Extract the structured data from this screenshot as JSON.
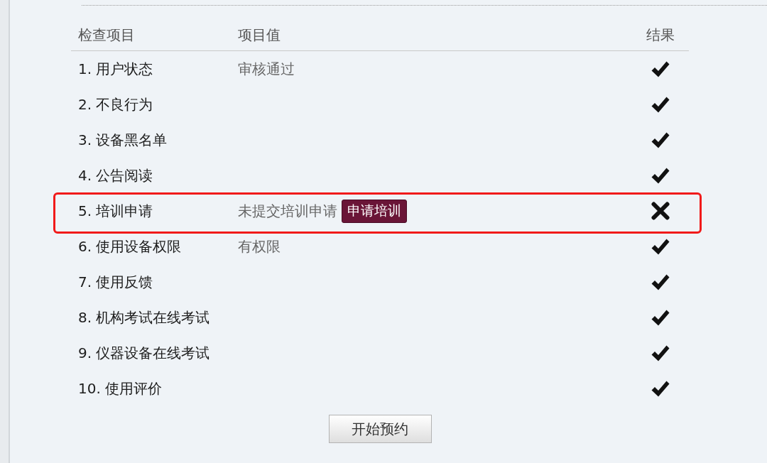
{
  "table": {
    "columns": [
      "检查项目",
      "项目值",
      "结果"
    ],
    "rows": [
      {
        "item": "1. 用户状态",
        "value": "审核通过",
        "passed": true,
        "highlighted": false
      },
      {
        "item": "2. 不良行为",
        "passed": true,
        "highlighted": false
      },
      {
        "item": "3. 设备黑名单",
        "passed": true,
        "highlighted": false
      },
      {
        "item": "4. 公告阅读",
        "passed": true,
        "highlighted": false
      },
      {
        "item": "5. 培训申请",
        "value": "未提交培训申请",
        "action": "申请培训",
        "passed": false,
        "highlighted": true
      },
      {
        "item": "6. 使用设备权限",
        "value": "有权限",
        "passed": true,
        "highlighted": false
      },
      {
        "item": "7. 使用反馈",
        "passed": true,
        "highlighted": false
      },
      {
        "item": "8. 机构考试在线考试",
        "passed": true,
        "highlighted": false
      },
      {
        "item": "9. 仪器设备在线考试",
        "passed": true,
        "highlighted": false
      },
      {
        "item": "10. 使用评价",
        "passed": true,
        "highlighted": false
      }
    ]
  },
  "start_button": {
    "label": "开始预约"
  }
}
